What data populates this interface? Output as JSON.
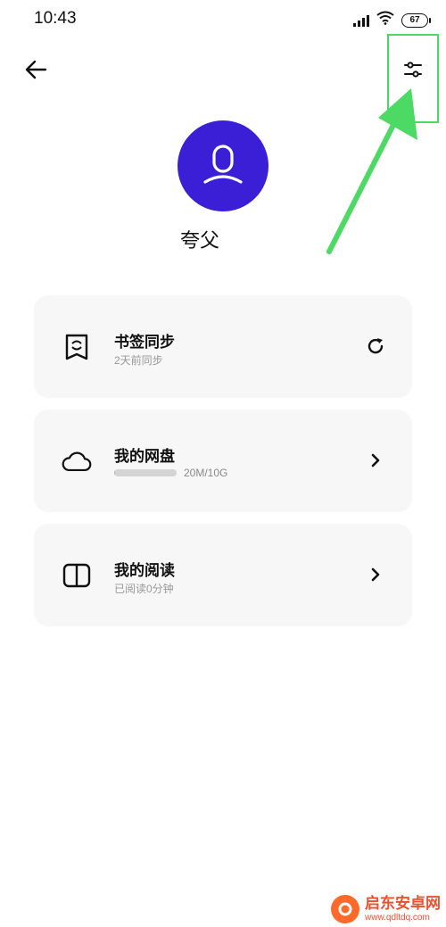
{
  "status_bar": {
    "time": "10:43",
    "battery": "67",
    "icons": [
      "signal-icon",
      "wifi-icon",
      "battery-icon"
    ]
  },
  "header": {
    "back_icon": "back-arrow-icon",
    "settings_icon": "sliders-icon"
  },
  "profile": {
    "avatar_icon": "user-avatar-icon",
    "avatar_color": "#3b1fd6",
    "name": "夸父"
  },
  "cards": [
    {
      "icon": "bookmark-sync-icon",
      "title": "书签同步",
      "subtitle": "2天前同步",
      "action_icon": "refresh-icon"
    },
    {
      "icon": "cloud-icon",
      "title": "我的网盘",
      "storage_text": "20M/10G",
      "storage_used_fraction": 0.002,
      "action_icon": "chevron-right-icon"
    },
    {
      "icon": "book-icon",
      "title": "我的阅读",
      "subtitle": "已阅读0分钟",
      "action_icon": "chevron-right-icon"
    }
  ],
  "annotation": {
    "color": "#4cd964"
  },
  "watermark": {
    "name": "启东安卓网",
    "url": "www.qdltdq.com"
  }
}
